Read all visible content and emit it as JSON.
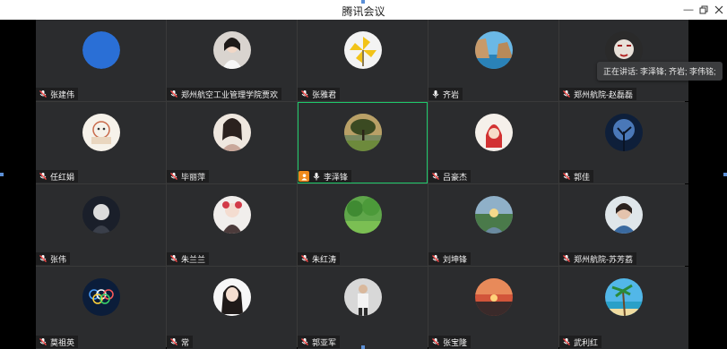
{
  "window": {
    "title": "腾讯会议"
  },
  "speaking": {
    "text": "正在讲话: 李泽锋; 齐岩; 李伟铭;"
  },
  "participants": [
    {
      "name": "张建伟",
      "mic": "muted",
      "avatar": "blue-circle"
    },
    {
      "name": "郑州航空工业管理学院贾欢",
      "mic": "muted",
      "avatar": "woman-portrait"
    },
    {
      "name": "张雅君",
      "mic": "muted",
      "avatar": "pinwheel"
    },
    {
      "name": "齐岩",
      "mic": "active",
      "avatar": "cliffs-sea"
    },
    {
      "name": "郑州航院-赵磊磊",
      "mic": "muted",
      "avatar": "painted-face"
    },
    {
      "name": "任红娟",
      "mic": "muted",
      "avatar": "cartoon-sketch"
    },
    {
      "name": "毕丽萍",
      "mic": "muted",
      "avatar": "woman-costume"
    },
    {
      "name": "李泽锋",
      "mic": "active",
      "host": true,
      "active": true,
      "avatar": "tree-sunset"
    },
    {
      "name": "吕豪杰",
      "mic": "muted",
      "avatar": "red-hood-cartoon"
    },
    {
      "name": "郭佳",
      "mic": "muted",
      "avatar": "night-tree"
    },
    {
      "name": "张伟",
      "mic": "muted",
      "avatar": "dark-figure"
    },
    {
      "name": "朱兰兰",
      "mic": "muted",
      "avatar": "flower-girl"
    },
    {
      "name": "朱红涛",
      "mic": "muted",
      "avatar": "green-forest"
    },
    {
      "name": "刘坤锋",
      "mic": "muted",
      "avatar": "river-sunset"
    },
    {
      "name": "郑州航院-苏芳荔",
      "mic": "muted",
      "avatar": "woman-photo"
    },
    {
      "name": "莫祖英",
      "mic": "muted",
      "avatar": "olympic-rings"
    },
    {
      "name": "常",
      "mic": "muted",
      "avatar": "long-hair-girl"
    },
    {
      "name": "郭亚军",
      "mic": "muted",
      "avatar": "man-standing"
    },
    {
      "name": "张宝隆",
      "mic": "muted",
      "avatar": "red-sunset"
    },
    {
      "name": "武利红",
      "mic": "muted",
      "avatar": "palm-beach"
    }
  ]
}
